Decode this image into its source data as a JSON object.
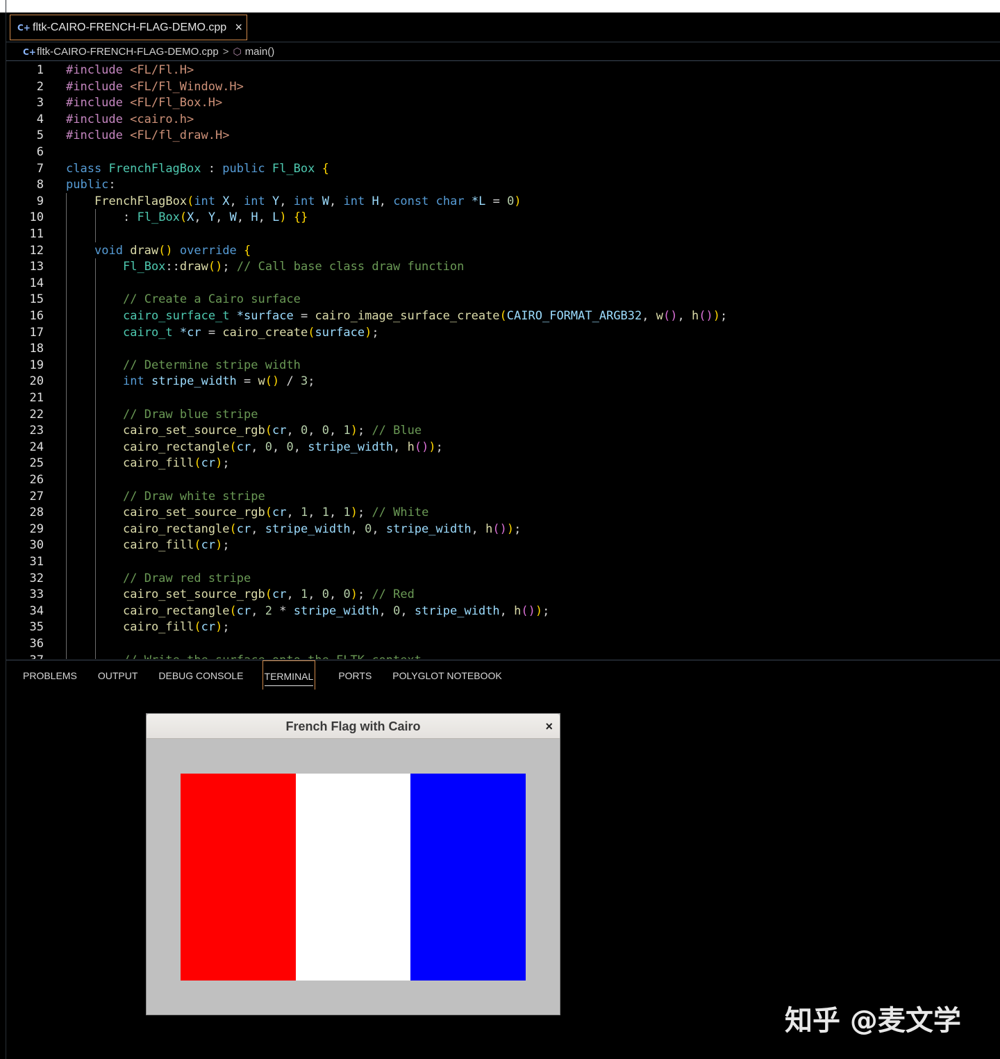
{
  "tab": {
    "icon": "cpp-file-icon",
    "title": "fltk-CAIRO-FRENCH-FLAG-DEMO.cpp",
    "close": "×"
  },
  "breadcrumb": {
    "file": "fltk-CAIRO-FRENCH-FLAG-DEMO.cpp",
    "separator": ">",
    "symbol": "main()"
  },
  "code_lines": [
    "#include <FL/Fl.H>",
    "#include <FL/Fl_Window.H>",
    "#include <FL/Fl_Box.H>",
    "#include <cairo.h>",
    "#include <FL/fl_draw.H>",
    "",
    "class FrenchFlagBox : public Fl_Box {",
    "public:",
    "    FrenchFlagBox(int X, int Y, int W, int H, const char *L = 0)",
    "        : Fl_Box(X, Y, W, H, L) {}",
    "",
    "    void draw() override {",
    "        Fl_Box::draw(); // Call base class draw function",
    "",
    "        // Create a Cairo surface",
    "        cairo_surface_t *surface = cairo_image_surface_create(CAIRO_FORMAT_ARGB32, w(), h());",
    "        cairo_t *cr = cairo_create(surface);",
    "",
    "        // Determine stripe width",
    "        int stripe_width = w() / 3;",
    "",
    "        // Draw blue stripe",
    "        cairo_set_source_rgb(cr, 0, 0, 1); // Blue",
    "        cairo_rectangle(cr, 0, 0, stripe_width, h());",
    "        cairo_fill(cr);",
    "",
    "        // Draw white stripe",
    "        cairo_set_source_rgb(cr, 1, 1, 1); // White",
    "        cairo_rectangle(cr, stripe_width, 0, stripe_width, h());",
    "        cairo_fill(cr);",
    "",
    "        // Draw red stripe",
    "        cairo_set_source_rgb(cr, 1, 0, 0); // Red",
    "        cairo_rectangle(cr, 2 * stripe_width, 0, stripe_width, h());",
    "        cairo_fill(cr);",
    "",
    "        // Write the surface onto the FLTK context"
  ],
  "panel_tabs": [
    "PROBLEMS",
    "OUTPUT",
    "DEBUG CONSOLE",
    "TERMINAL",
    "PORTS",
    "POLYGLOT NOTEBOOK"
  ],
  "active_panel_tab": "TERMINAL",
  "app_window": {
    "title": "French Flag with Cairo",
    "close": "×",
    "background": "#c0c0c0",
    "stripes": [
      {
        "name": "red",
        "color": "#ff0000"
      },
      {
        "name": "white",
        "color": "#ffffff"
      },
      {
        "name": "blue",
        "color": "#0000ff"
      }
    ]
  },
  "watermark": "知乎 @麦文学",
  "colors": {
    "accent_border": "#d18a4a",
    "editor_bg": "#000000"
  }
}
